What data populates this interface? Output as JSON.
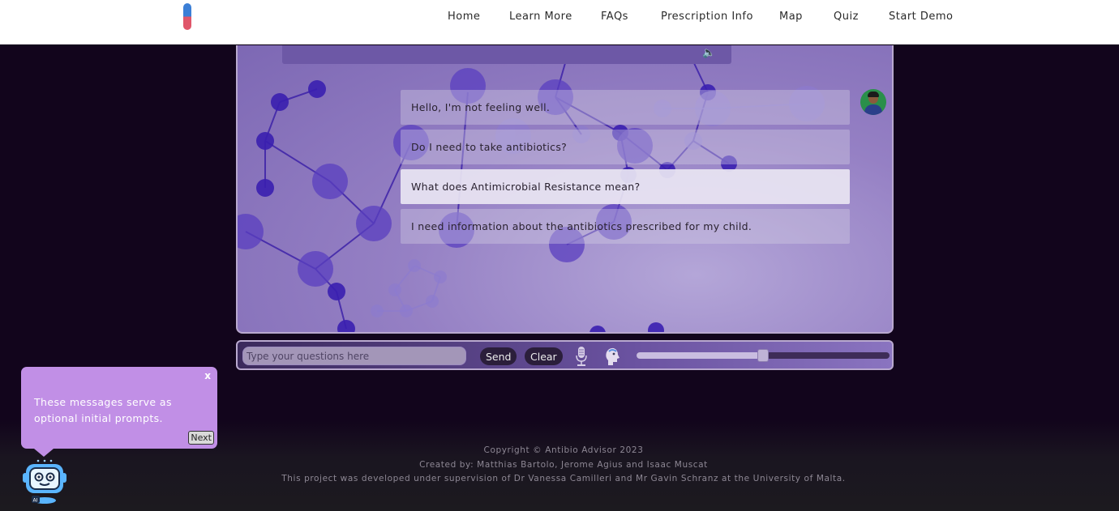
{
  "nav": {
    "links": [
      "Home",
      "Learn More",
      "FAQs",
      "Prescription Info",
      "Map",
      "Quiz",
      "Start Demo"
    ]
  },
  "chat": {
    "prompts": [
      "Hello, I'm not feeling well.",
      "Do I need to take antibiotics?",
      "What does Antimicrobial Resistance mean?",
      "I need information about the antibiotics prescribed for my child."
    ],
    "active_prompt_index": 2
  },
  "input_bar": {
    "placeholder": "Type your questions here",
    "send_label": "Send",
    "clear_label": "Clear",
    "slider_value": 0.5
  },
  "tooltip": {
    "close_label": "x",
    "text": "These messages serve as optional initial prompts.",
    "next_label": "Next"
  },
  "footer": {
    "copyright": "Copyright © Antibio Advisor 2023",
    "created_by": "Created by: Matthias Bartolo, Jerome Agius and Isaac Muscat",
    "supervision": "This project was developed under supervision of Dr Vanessa Camilleri and Mr Gavin Schranz at the University of Malta."
  },
  "icons": {
    "logo": "pill-logo-icon",
    "speaker": "speaker-icon",
    "mic": "microphone-icon",
    "face": "speaking-head-icon",
    "robot": "robot-assistant-icon"
  },
  "colors": {
    "accent": "#c18fe6",
    "panel": "#9580c4",
    "background": "#12051c"
  }
}
